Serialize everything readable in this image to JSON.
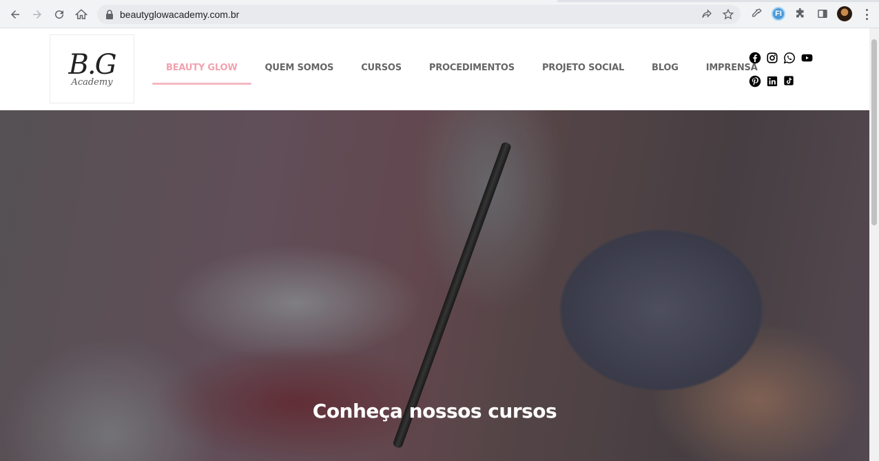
{
  "browser": {
    "url": "beautyglowacademy.com.br",
    "extension_label": "FI"
  },
  "logo": {
    "mark": "B.G",
    "sub": "Academy"
  },
  "menu": {
    "items": [
      {
        "label": "BEAUTY GLOW",
        "active": true
      },
      {
        "label": "QUEM SOMOS"
      },
      {
        "label": "CURSOS"
      },
      {
        "label": "PROCEDIMENTOS"
      },
      {
        "label": "PROJETO SOCIAL"
      },
      {
        "label": "BLOG"
      },
      {
        "label": "IMPRENSA"
      }
    ]
  },
  "social": [
    "facebook-icon",
    "instagram-icon",
    "whatsapp-icon",
    "youtube-icon",
    "pinterest-icon",
    "linkedin-icon",
    "tiktok-icon"
  ],
  "hero": {
    "title": "Conheça nossos cursos"
  },
  "colors": {
    "accent": "#f2a2ae",
    "menu_text": "#666666"
  }
}
